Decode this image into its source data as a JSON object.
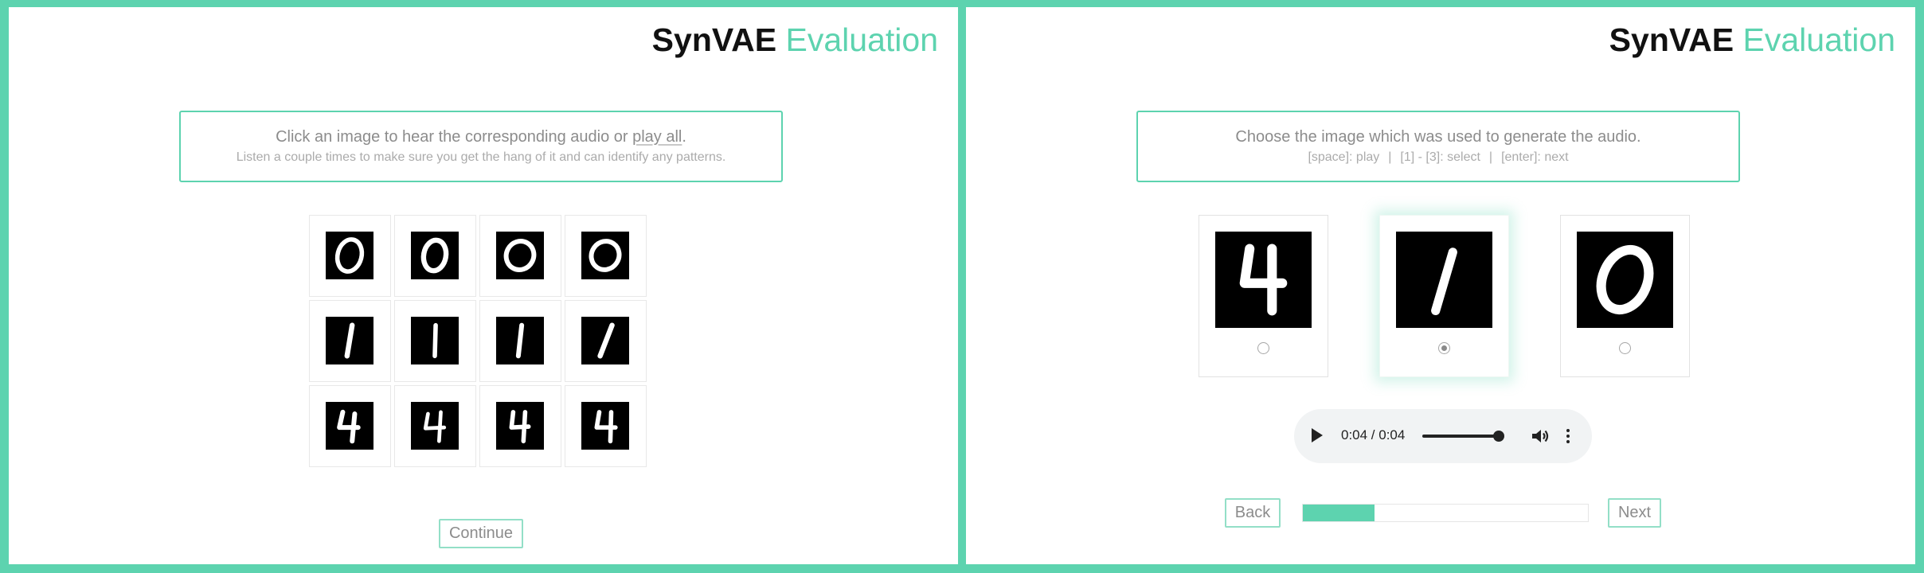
{
  "left_panel": {
    "brand": {
      "main": "SynVAE",
      "accent": "Evaluation"
    },
    "instructions": {
      "main_prefix": "Click an image to hear the corresponding audio or",
      "link": "play all",
      "main_suffix": ".",
      "sub": "Listen a couple times to make sure you get the hang of it and can identify any patterns."
    },
    "digits": [
      [
        "0",
        "0",
        "0",
        "0"
      ],
      [
        "1",
        "1",
        "1",
        "1"
      ],
      [
        "4",
        "4",
        "4",
        "4"
      ]
    ],
    "continue_label": "Continue"
  },
  "right_panel": {
    "brand": {
      "main": "SynVAE",
      "accent": "Evaluation"
    },
    "instructions": {
      "main": "Choose the image which was used to generate the audio.",
      "hints": [
        "[space]: play",
        "[1] - [3]: select",
        "[enter]: next"
      ],
      "separator": "|"
    },
    "choices": [
      {
        "digit": "4",
        "selected": false
      },
      {
        "digit": "1",
        "selected": true
      },
      {
        "digit": "0",
        "selected": false
      }
    ],
    "audio": {
      "time": "0:04 / 0:04",
      "progress": 1.0,
      "icons": [
        "play-icon",
        "volume-icon",
        "more-vert-icon"
      ]
    },
    "back_label": "Back",
    "next_label": "Next",
    "progress": 0.25
  },
  "colors": {
    "accent": "#5dd3af",
    "text_gray": "#8c8c8c",
    "digit_bg": "#000000",
    "digit_fg": "#ffffff"
  }
}
